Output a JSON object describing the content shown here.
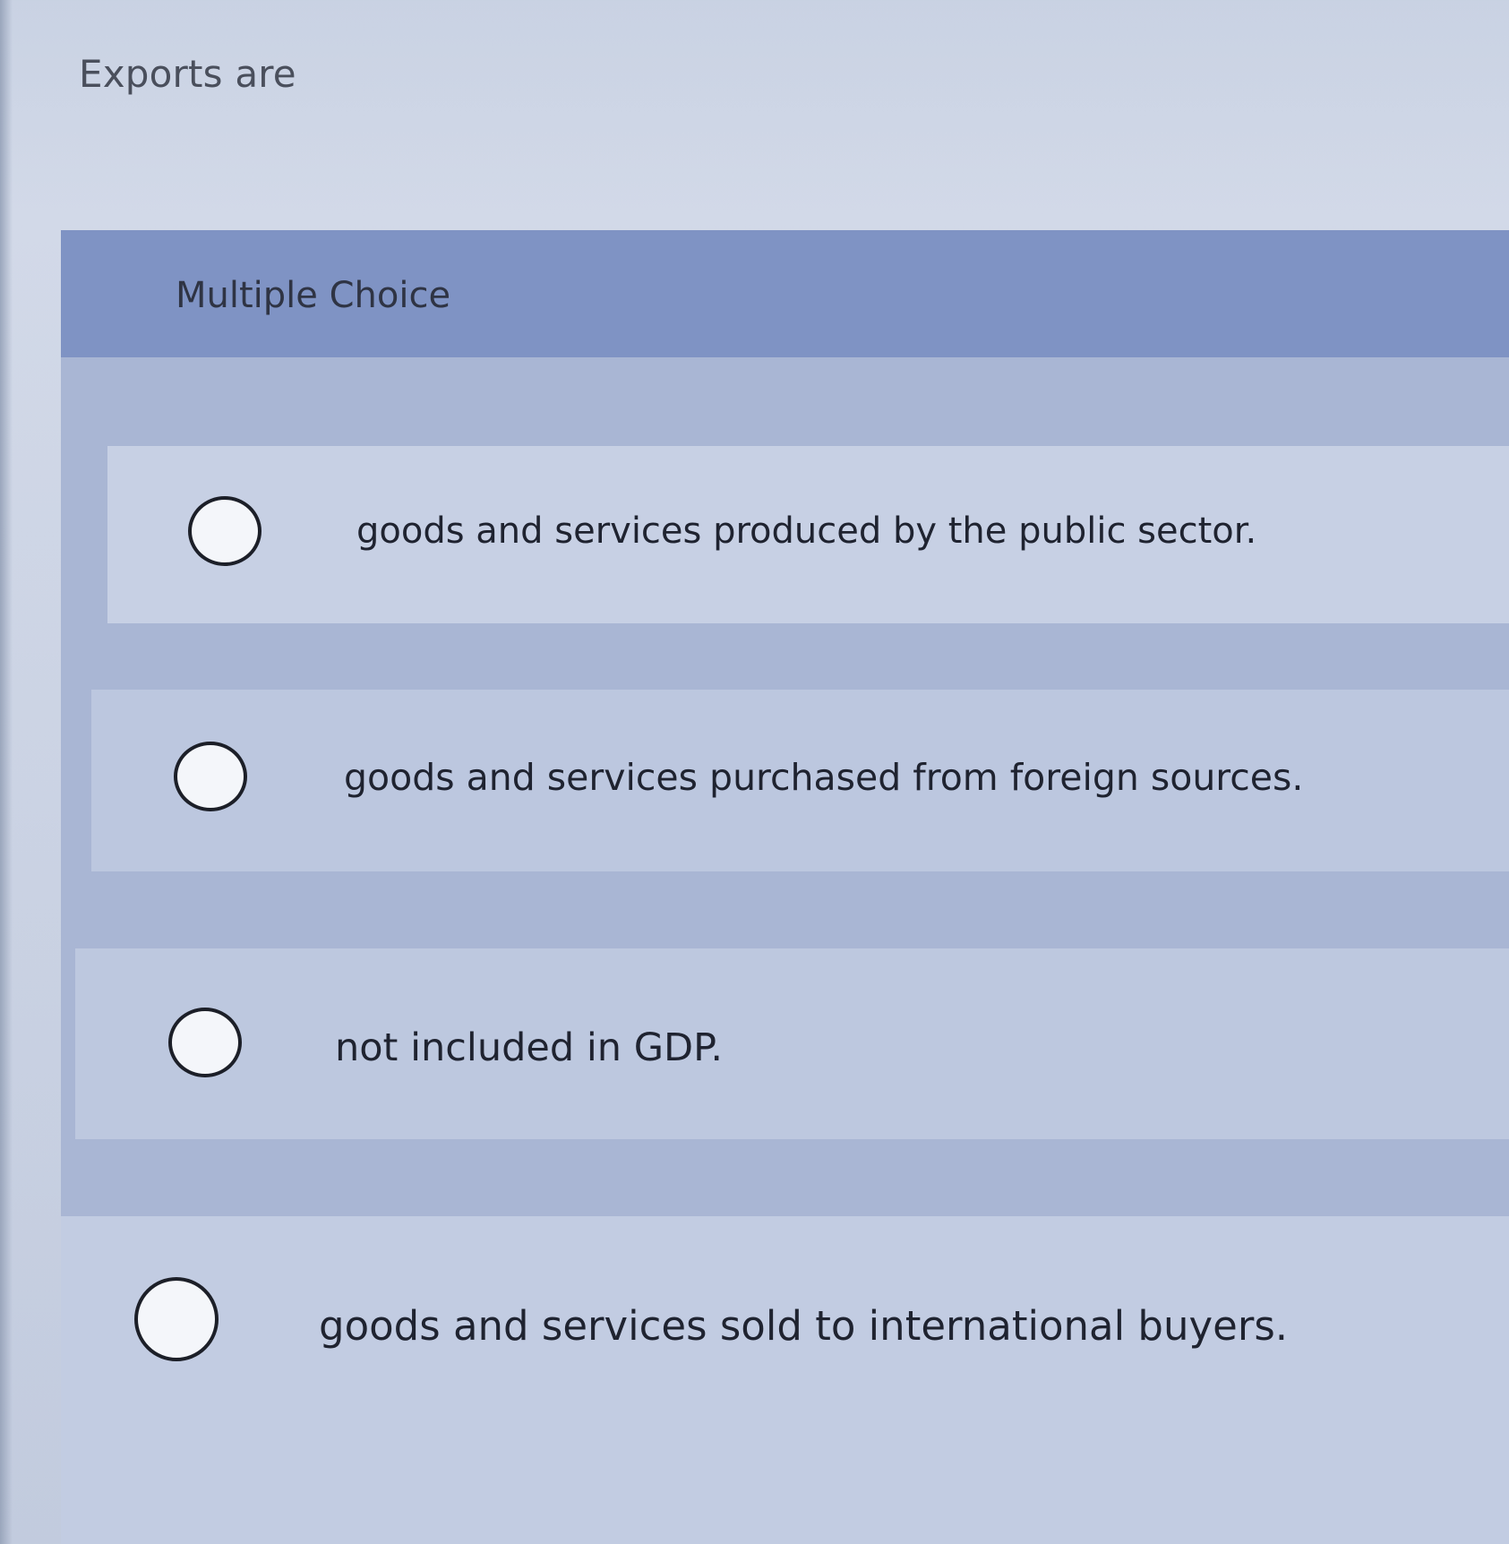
{
  "question": {
    "text": "Exports are"
  },
  "multiple_choice": {
    "label": "Multiple Choice",
    "options": [
      {
        "text": "goods and services produced by the public sector.",
        "selected": false
      },
      {
        "text": "goods and services purchased from foreign sources.",
        "selected": false
      },
      {
        "text": "not included in GDP.",
        "selected": false
      },
      {
        "text": "goods and services sold to international buyers.",
        "selected": false
      }
    ]
  },
  "icons": {
    "radio": "radio-button-unselected-icon"
  },
  "colors": {
    "background": "#c9d2e3",
    "header": "#7f93c4",
    "option_background": "#c7d0e4"
  }
}
